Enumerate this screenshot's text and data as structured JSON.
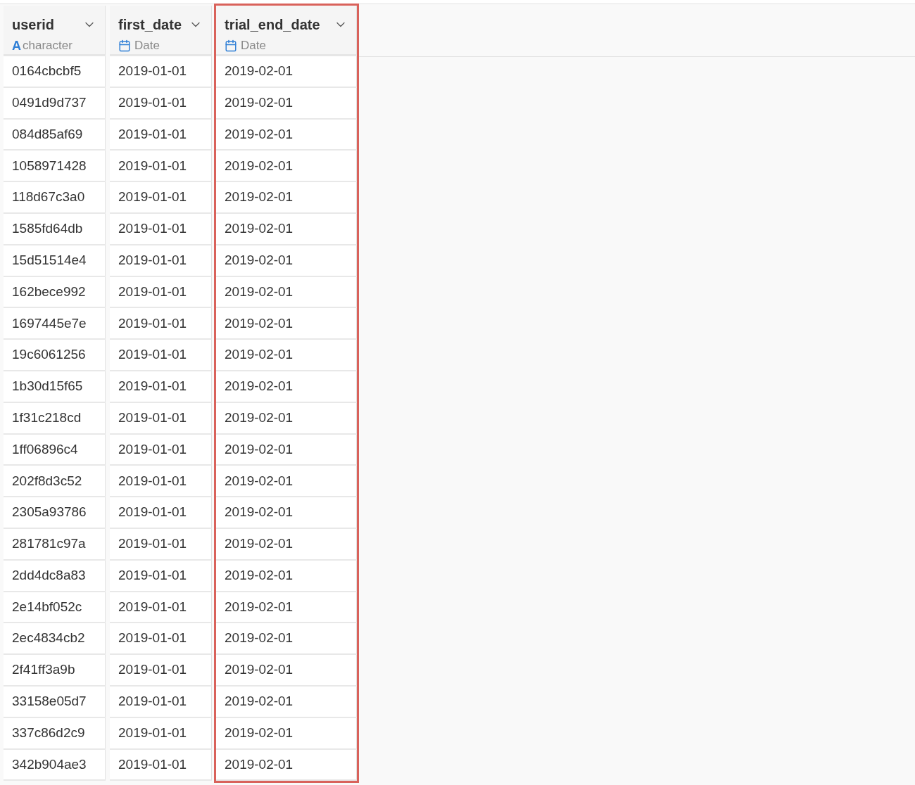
{
  "table": {
    "columns": [
      {
        "name": "userid",
        "kind": "character",
        "type_icon": "A",
        "type": "character",
        "highlighted": false
      },
      {
        "name": "first_date",
        "kind": "date",
        "type": "Date",
        "highlighted": false
      },
      {
        "name": "trial_end_date",
        "kind": "date",
        "type": "Date",
        "highlighted": true
      }
    ],
    "rows": [
      [
        "0164cbcbf5",
        "2019-01-01",
        "2019-02-01"
      ],
      [
        "0491d9d737",
        "2019-01-01",
        "2019-02-01"
      ],
      [
        "084d85af69",
        "2019-01-01",
        "2019-02-01"
      ],
      [
        "1058971428",
        "2019-01-01",
        "2019-02-01"
      ],
      [
        "118d67c3a0",
        "2019-01-01",
        "2019-02-01"
      ],
      [
        "1585fd64db",
        "2019-01-01",
        "2019-02-01"
      ],
      [
        "15d51514e4",
        "2019-01-01",
        "2019-02-01"
      ],
      [
        "162bece992",
        "2019-01-01",
        "2019-02-01"
      ],
      [
        "1697445e7e",
        "2019-01-01",
        "2019-02-01"
      ],
      [
        "19c6061256",
        "2019-01-01",
        "2019-02-01"
      ],
      [
        "1b30d15f65",
        "2019-01-01",
        "2019-02-01"
      ],
      [
        "1f31c218cd",
        "2019-01-01",
        "2019-02-01"
      ],
      [
        "1ff06896c4",
        "2019-01-01",
        "2019-02-01"
      ],
      [
        "202f8d3c52",
        "2019-01-01",
        "2019-02-01"
      ],
      [
        "2305a93786",
        "2019-01-01",
        "2019-02-01"
      ],
      [
        "281781c97a",
        "2019-01-01",
        "2019-02-01"
      ],
      [
        "2dd4dc8a83",
        "2019-01-01",
        "2019-02-01"
      ],
      [
        "2e14bf052c",
        "2019-01-01",
        "2019-02-01"
      ],
      [
        "2ec4834cb2",
        "2019-01-01",
        "2019-02-01"
      ],
      [
        "2f41ff3a9b",
        "2019-01-01",
        "2019-02-01"
      ],
      [
        "33158e05d7",
        "2019-01-01",
        "2019-02-01"
      ],
      [
        "337c86d2c9",
        "2019-01-01",
        "2019-02-01"
      ],
      [
        "342b904ae3",
        "2019-01-01",
        "2019-02-01"
      ]
    ]
  }
}
